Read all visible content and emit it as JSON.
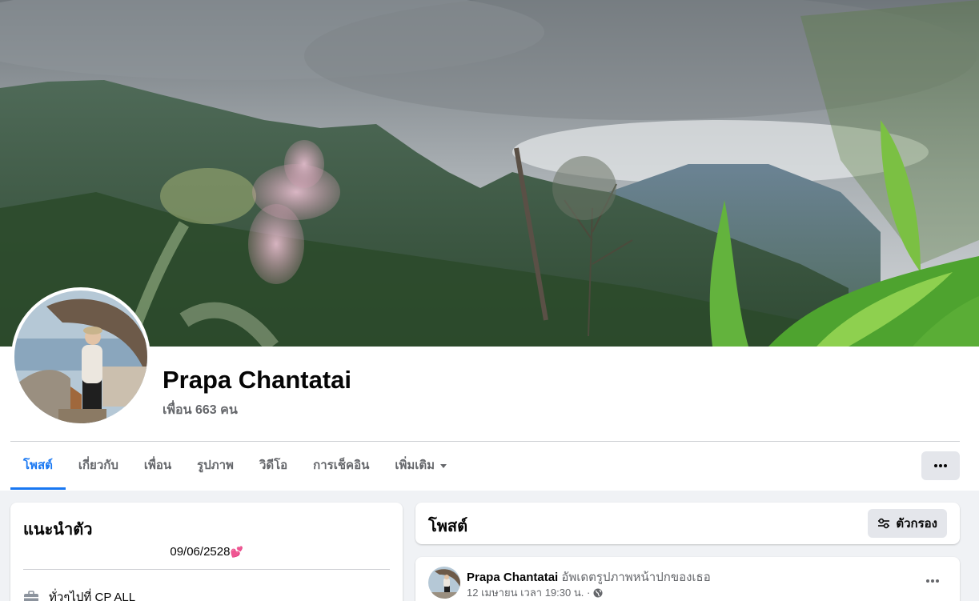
{
  "profile": {
    "name": "Prapa Chantatai",
    "friends_text": "เพื่อน 663 คน"
  },
  "tabs": [
    {
      "label": "โพสต์",
      "active": true
    },
    {
      "label": "เกี่ยวกับ",
      "active": false
    },
    {
      "label": "เพื่อน",
      "active": false
    },
    {
      "label": "รูปภาพ",
      "active": false
    },
    {
      "label": "วิดีโอ",
      "active": false
    },
    {
      "label": "การเช็คอิน",
      "active": false
    },
    {
      "label": "เพิ่มเติม",
      "active": false,
      "has_dropdown": true
    }
  ],
  "intro": {
    "title": "แนะนำตัว",
    "bio_text": "09/06/2528",
    "bio_emoji": "💕",
    "work_text": "ทั่วๆไปที่ CP ALL"
  },
  "posts_header": {
    "title": "โพสต์",
    "filter_label": "ตัวกรอง"
  },
  "post": {
    "author": "Prapa Chantatai",
    "action": "อัพเดตรูปภาพหน้าปกของเธอ",
    "timestamp": "12 เมษายน เวลา 19:30 น. ·"
  },
  "colors": {
    "accent": "#1877f2",
    "background": "#f0f2f5",
    "secondary_text": "#65676b",
    "button_bg": "#e4e6eb"
  },
  "icons": {
    "more": "three-dots-icon",
    "filter": "filter-sliders-icon",
    "work": "briefcase-icon",
    "privacy": "globe-icon",
    "dropdown": "caret-down-icon"
  }
}
